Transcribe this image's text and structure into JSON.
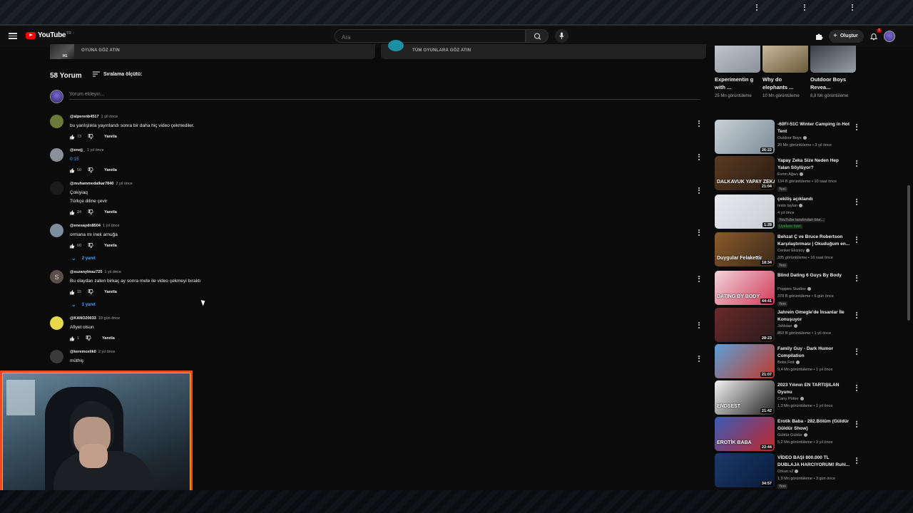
{
  "masthead": {
    "logo_text": "YouTube",
    "logo_region": "TR",
    "search_placeholder": "Ara",
    "create_label": "Oluştur",
    "notification_count": "7"
  },
  "game_strip": {
    "left_link": "OYUNA GÖZ ATIN",
    "left_badge": "H1",
    "right_link": "TÜM OYUNLARA GÖZ ATIN"
  },
  "comments": {
    "count_label": "58 Yorum",
    "sort_label": "Sıralama ölçütü:",
    "add_placeholder": "Yorum ekleyin...",
    "reply_label": "Yanıtla",
    "items": [
      {
        "author": "@alperenb4517",
        "time": "1 yıl önce",
        "lines": [
          "bu yanlışlıkla yayınlandı sonra bir daha hiç video çekmediler."
        ],
        "likes": "73",
        "avatar_color": "#6b7a3a"
      },
      {
        "author": "@enejj_",
        "time": "1 yıl önce",
        "lines": [
          "0:15"
        ],
        "likes": "50",
        "avatar_color": "#8a8f99"
      },
      {
        "author": "@muhammedalkar7840",
        "time": "2 yıl önce",
        "lines": [
          "Çokiyiaq",
          "Türkçe diline çevir"
        ],
        "likes": "24",
        "avatar_color": "#1b1b1b"
      },
      {
        "author": "@enesaydn8504",
        "time": "1 yıl önce",
        "lines": [
          "ormana mı inek arnuğa"
        ],
        "likes": "60",
        "avatar_color": "#7d8f9f",
        "replies": "2 yanıt"
      },
      {
        "author": "@suzanylmaz725",
        "time": "1 yıl önce",
        "lines": [
          "Bu olaydan zaten birkaç ay sonra mete ile video çekmeyi bıraktı"
        ],
        "likes": "15",
        "avatar_color": "#5c4d4d",
        "avatar_letter": "S",
        "replies": "1 yanıt"
      },
      {
        "author": "@KANO20033",
        "time": "10 gün önce",
        "lines": [
          "Afiyet olsun"
        ],
        "likes": "1",
        "avatar_color": "#e8d84a"
      },
      {
        "author": "@keremcelik0",
        "time": "2 yıl önce",
        "lines": [
          "müthiş"
        ],
        "likes": "",
        "avatar_color": "#3a3a3a"
      }
    ]
  },
  "sidebar": {
    "top_row": [
      {
        "title": "Experimentin g with ...",
        "views": "25 Mn görüntüleme"
      },
      {
        "title": "Why do elephants ...",
        "views": "10 Mn görüntüleme"
      },
      {
        "title": "Outdoor Boys Revea...",
        "views": "8,8 Mn görüntüleme"
      }
    ],
    "items": [
      {
        "title": "-60F/-51C Winter Camping in Hot Tent",
        "channel": "Outdoor Boys",
        "meta": "20 Mn görüntüleme • 3 yıl önce",
        "duration": "26:22",
        "colors": [
          "#c8d2da",
          "#7b8a94"
        ]
      },
      {
        "title": "Yapay Zeka Size Neden Hep Yalan Söylüyor?",
        "channel": "Evrim Ağacı",
        "meta": "134 B görüntüleme • 10 saat önce",
        "duration": "21:04",
        "badge": "Yeni",
        "thumb_text": "DALKAVUK YAPAY ZEKA!",
        "colors": [
          "#5a3a22",
          "#2a1c12"
        ]
      },
      {
        "title": "çekiliş açıklandı",
        "channel": "testo taylan",
        "meta": "4 yıl önce",
        "duration": "1:28",
        "note": "YouTube tarafından öne...",
        "members": "Üyelere özel",
        "colors": [
          "#e8eaee",
          "#c9ccd2"
        ]
      },
      {
        "title": "Behzat Ç ve Bruce Robertson Karşılaştırması | Okuduğum en...",
        "channel": "Cenker Ekizsoy",
        "meta": "335 görüntüleme • 16 saat önce",
        "duration": "18:34",
        "badge": "Yeni",
        "thumb_text": "Duygular Felakettir",
        "colors": [
          "#8a5a2a",
          "#3a2a1a"
        ]
      },
      {
        "title": "Blind Dating 6 Guys By Body",
        "channel": "Poppies Studios",
        "meta": "378 B görüntüleme • 6 gün önce",
        "duration": "44:41",
        "badge": "Yeni",
        "thumb_text": "DATING BY BODY",
        "colors": [
          "#f2d4d9",
          "#d13a5a"
        ]
      },
      {
        "title": "Jahrein Omegle'de İnsanlar İle Konuşuyor",
        "channel": "Jahlstan",
        "meta": "853 B görüntüleme • 1 yıl önce",
        "duration": "28:23",
        "colors": [
          "#6a2a2a",
          "#2a1a1a"
        ]
      },
      {
        "title": "Family Guy - Dark Humor Compilation",
        "channel": "Bobs Fett",
        "meta": "9,4 Mn görüntüleme • 1 yıl önce",
        "duration": "21:07",
        "colors": [
          "#5aa0d8",
          "#c23a2a"
        ]
      },
      {
        "title": "2023 Yılının EN TARTIŞILAN Oyunu",
        "channel": "Carry Potter",
        "meta": "1,3 Mn görüntüleme • 1 yıl önce",
        "duration": "21:42",
        "thumb_text": "ENDSEST",
        "colors": [
          "#f4f4f4",
          "#222"
        ]
      },
      {
        "title": "Erotik Baba - 282.Bölüm (Güldür Güldür Show)",
        "channel": "Güldür Güldür",
        "meta": "5,2 Mn görüntüleme • 3 yıl önce",
        "duration": "22:44",
        "thumb_text": "EROTİK BABA",
        "colors": [
          "#3a5ab8",
          "#c2282a"
        ]
      },
      {
        "title": "VİDEO BAŞI 800.000 TL DUBLAJA HARCIYORUM! Ruhl...",
        "channel": "Orkun v2",
        "meta": "1,9 Mn görüntüleme • 3 gün önce",
        "duration": "34:57",
        "badge": "Yeni",
        "colors": [
          "#1a3a6a",
          "#0a1a3a"
        ]
      }
    ]
  }
}
